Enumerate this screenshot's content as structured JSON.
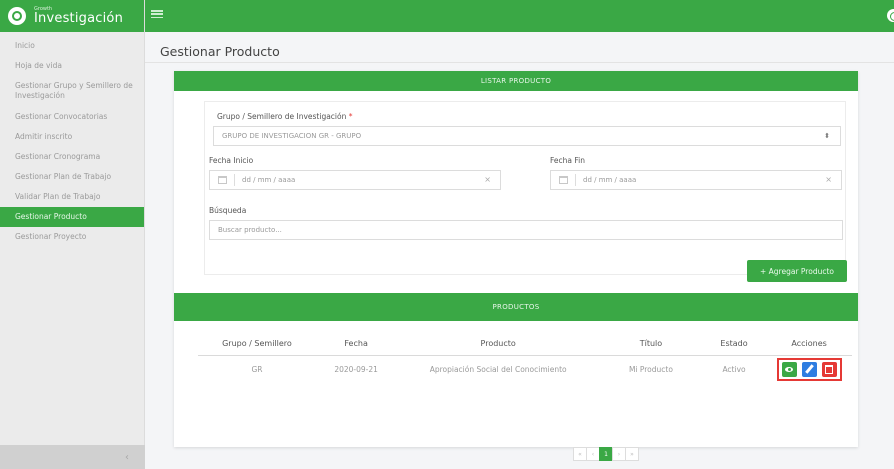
{
  "brand": {
    "small": "Growth",
    "title": "Investigación"
  },
  "sidebar": {
    "items": [
      {
        "label": "Inicio"
      },
      {
        "label": "Hoja de vida"
      },
      {
        "label": "Gestionar Grupo y Semillero de Investigación"
      },
      {
        "label": "Gestionar Convocatorias"
      },
      {
        "label": "Admitir inscrito"
      },
      {
        "label": "Gestionar Cronograma"
      },
      {
        "label": "Gestionar Plan de Trabajo"
      },
      {
        "label": "Validar Plan de Trabajo"
      },
      {
        "label": "Gestionar Producto",
        "active": true
      },
      {
        "label": "Gestionar Proyecto"
      }
    ],
    "collapse_glyph": "‹"
  },
  "page": {
    "title": "Gestionar Producto"
  },
  "listar": {
    "header": "LISTAR PRODUCTO",
    "group_label": "Grupo / Semillero de Investigación",
    "required_mark": "*",
    "group_value": "GRUPO DE INVESTIGACION GR - GRUPO",
    "select_caret": "⬍",
    "fecha_inicio_label": "Fecha Inicio",
    "fecha_inicio_placeholder": "dd / mm / aaaa",
    "fecha_fin_label": "Fecha Fin",
    "fecha_fin_placeholder": "dd / mm / aaaa",
    "clear_glyph": "×",
    "busqueda_label": "Búsqueda",
    "busqueda_placeholder": "Buscar producto...",
    "add_button": "+ Agregar Producto"
  },
  "productos": {
    "header": "PRODUCTOS",
    "columns": [
      "Grupo / Semillero",
      "Fecha",
      "Producto",
      "Título",
      "Estado",
      "Acciones"
    ],
    "rows": [
      {
        "grupo": "GR",
        "fecha": "2020-09-21",
        "producto": "Apropiación Social del Conocimiento",
        "titulo": "Mi Producto",
        "estado": "Activo"
      }
    ]
  },
  "pagination": {
    "first": "«",
    "prev": "‹",
    "current": "1",
    "next": "›",
    "last": "»"
  },
  "colors": {
    "brand_green": "#3aa845",
    "edit_blue": "#2e7de1",
    "delete_red": "#e53935"
  },
  "icons": [
    "logo-icon",
    "menu-icon",
    "user-icon",
    "calendar-icon",
    "eye-icon",
    "pencil-icon",
    "trash-icon"
  ]
}
